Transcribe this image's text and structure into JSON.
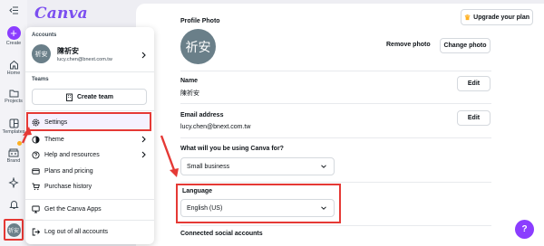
{
  "rail": {
    "items": [
      {
        "label": "",
        "icon": "collapse-sidebar-icon"
      },
      {
        "label": "Create",
        "icon": "plus-icon"
      },
      {
        "label": "Home",
        "icon": "home-icon"
      },
      {
        "label": "Projects",
        "icon": "folder-icon"
      },
      {
        "label": "Templates",
        "icon": "templates-icon"
      },
      {
        "label": "Brand",
        "icon": "brand-icon"
      },
      {
        "label": "",
        "icon": "sparkle-icon"
      },
      {
        "label": "",
        "icon": "bell-icon"
      }
    ],
    "avatar_text": "祈安"
  },
  "logo": "Canva",
  "menu": {
    "accounts_heading": "Accounts",
    "avatar_text": "祈安",
    "user_name": "陳祈安",
    "user_email": "lucy.chen@bnext.com.tw",
    "teams_heading": "Teams",
    "create_team_label": "Create team",
    "items": [
      {
        "label": "Settings",
        "icon": "gear-icon"
      },
      {
        "label": "Theme",
        "icon": "theme-icon"
      },
      {
        "label": "Help and resources",
        "icon": "help-icon"
      },
      {
        "label": "Plans and pricing",
        "icon": "card-icon"
      },
      {
        "label": "Purchase history",
        "icon": "cart-icon"
      },
      {
        "label": "Get the Canva Apps",
        "icon": "apps-icon"
      },
      {
        "label": "Log out of all accounts",
        "icon": "logout-icon"
      }
    ]
  },
  "settings": {
    "upgrade_label": "Upgrade your plan",
    "profile_photo_label": "Profile Photo",
    "profile_avatar_text": "祈安",
    "remove_photo_label": "Remove photo",
    "change_photo_label": "Change photo",
    "name_label": "Name",
    "name_value": "陳祈安",
    "email_label": "Email address",
    "email_value": "lucy.chen@bnext.com.tw",
    "edit_label": "Edit",
    "use_label": "What will you be using Canva for?",
    "use_value": "Small business",
    "language_label": "Language",
    "language_value": "English (US)",
    "social_label": "Connected social accounts",
    "help_fab_label": "?"
  },
  "colors": {
    "accent": "#8b3dff",
    "highlight": "#e53935"
  }
}
